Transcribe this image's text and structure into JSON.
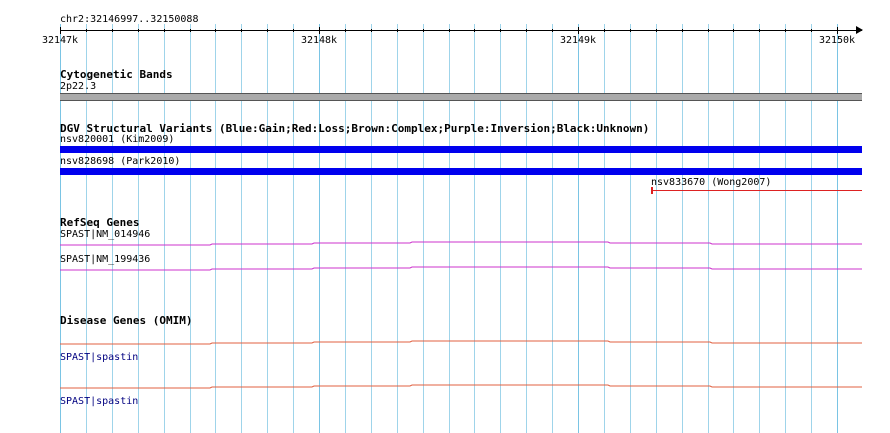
{
  "ruler": {
    "region": "chr2:32146997..32150088",
    "ticks": [
      "32147k",
      "32148k",
      "32149k",
      "32150k"
    ]
  },
  "cytoband": {
    "title": "Cytogenetic Bands",
    "band": "2p22.3"
  },
  "dgv": {
    "title": "DGV Structural Variants (Blue:Gain;Red:Loss;Brown:Complex;Purple:Inversion;Black:Unknown)",
    "variants": [
      {
        "label": "nsv820001 (Kim2009)",
        "type": "Gain",
        "color": "#0000ee"
      },
      {
        "label": "nsv828698 (Park2010)",
        "type": "Gain",
        "color": "#0000ee"
      },
      {
        "label": "nsv833670 (Wong2007)",
        "type": "Loss",
        "color": "#dd2222"
      }
    ]
  },
  "refseq": {
    "title": "RefSeq Genes",
    "color": "#cc33cc",
    "genes": [
      {
        "label": "SPAST|NM_014946"
      },
      {
        "label": "SPAST|NM_199436"
      }
    ]
  },
  "omim": {
    "title": "Disease Genes (OMIM)",
    "color": "#e06040",
    "genes": [
      {
        "label": "SPAST|spastin"
      },
      {
        "label": "SPAST|spastin"
      }
    ]
  },
  "colors": {
    "grid_line": "#9fd4ea",
    "band_fill": "#aaaaaa"
  }
}
